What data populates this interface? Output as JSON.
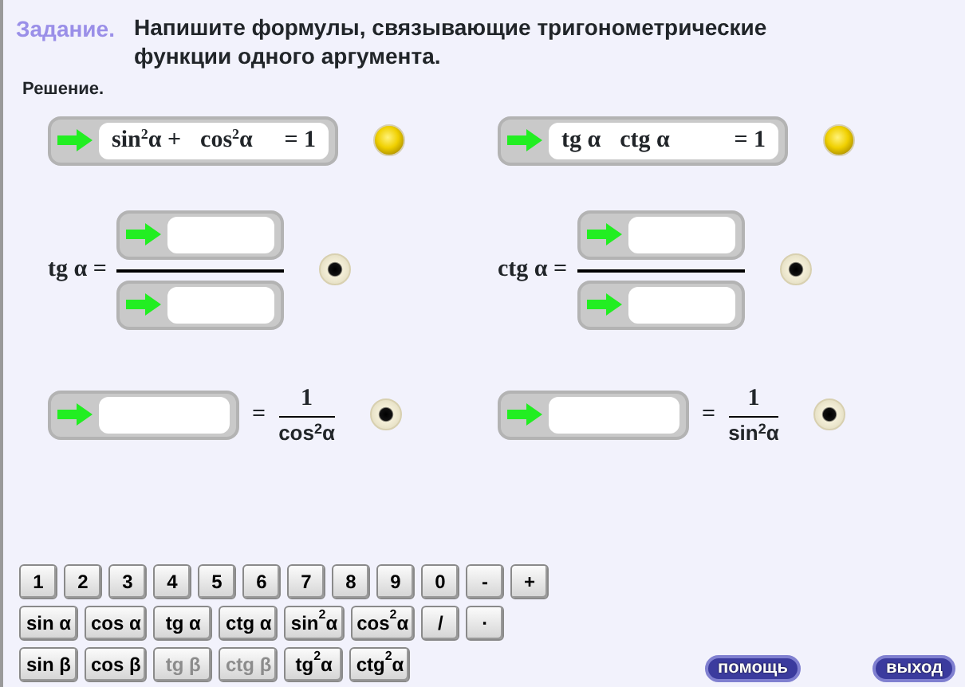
{
  "task": {
    "label": "Задание.",
    "text": "Напишите формулы, связывающие тригонометрические функции одного аргумента."
  },
  "solution_label": "Решение.",
  "identities": [
    {
      "terms": [
        "sin$^{2}$α +",
        "cos$^{2}$α"
      ],
      "result": "= 1",
      "solved": true
    },
    {
      "terms": [
        "tg α",
        "ctg α"
      ],
      "result": "= 1",
      "solved": true
    }
  ],
  "fractions": [
    {
      "label": "tg α =",
      "solved": false
    },
    {
      "label": "ctg α =",
      "solved": false
    }
  ],
  "reciprocals": [
    {
      "equals": "=",
      "numerator": "1",
      "denominator": "cos$^{2}$α",
      "solved": false
    },
    {
      "equals": "=",
      "numerator": "1",
      "denominator": "sin$^{2}$α",
      "solved": false
    }
  ],
  "keypad": [
    [
      {
        "label": "1",
        "kind": "digit",
        "disabled": false
      },
      {
        "label": "2",
        "kind": "digit",
        "disabled": false
      },
      {
        "label": "3",
        "kind": "digit",
        "disabled": false
      },
      {
        "label": "4",
        "kind": "digit",
        "disabled": false
      },
      {
        "label": "5",
        "kind": "digit",
        "disabled": false
      },
      {
        "label": "6",
        "kind": "digit",
        "disabled": false
      },
      {
        "label": "7",
        "kind": "digit",
        "disabled": false
      },
      {
        "label": "8",
        "kind": "digit",
        "disabled": false
      },
      {
        "label": "9",
        "kind": "digit",
        "disabled": false
      },
      {
        "label": "0",
        "kind": "digit",
        "disabled": false
      },
      {
        "label": "-",
        "kind": "digit",
        "disabled": false
      },
      {
        "label": "+",
        "kind": "digit",
        "disabled": false
      }
    ],
    [
      {
        "label": "sin α",
        "kind": "function",
        "disabled": false
      },
      {
        "label": "cos α",
        "kind": "function",
        "disabled": false
      },
      {
        "label": "tg α",
        "kind": "function",
        "disabled": false
      },
      {
        "label": "ctg α",
        "kind": "function",
        "disabled": false
      },
      {
        "label": "sin$^{2}$α",
        "kind": "function",
        "disabled": false
      },
      {
        "label": "cos$^{2}$α",
        "kind": "function",
        "disabled": false
      },
      {
        "label": "/",
        "kind": "digit",
        "disabled": false
      },
      {
        "label": "·",
        "kind": "digit",
        "disabled": false
      }
    ],
    [
      {
        "label": "sin β",
        "kind": "function",
        "disabled": false
      },
      {
        "label": "cos β",
        "kind": "function",
        "disabled": false
      },
      {
        "label": "tg β",
        "kind": "function",
        "disabled": true
      },
      {
        "label": "ctg β",
        "kind": "function",
        "disabled": true
      },
      {
        "label": "tg$^{2}$α",
        "kind": "function",
        "disabled": false
      },
      {
        "label": "ctg$^{2}$α",
        "kind": "function",
        "disabled": false
      }
    ]
  ],
  "buttons": [
    {
      "label": "помощь"
    },
    {
      "label": "выход"
    }
  ]
}
